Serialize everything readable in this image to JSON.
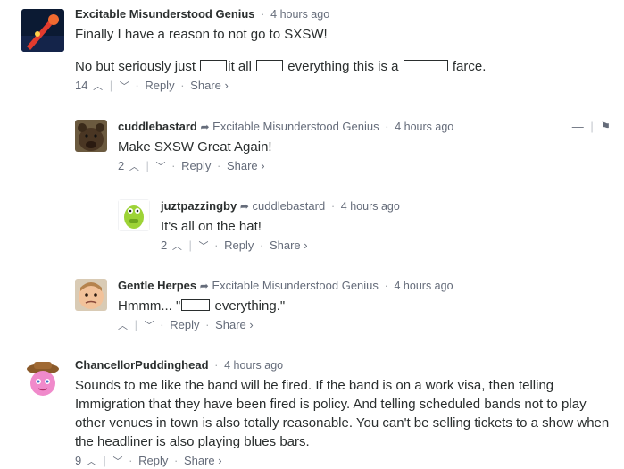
{
  "comments": [
    {
      "author": "Excitable Misunderstood Genius",
      "time": "4 hours ago",
      "lines": [
        "Finally I have a reason to not go to SXSW!"
      ],
      "line2": {
        "a": "No but seriously just",
        "b": "it all",
        "c": "everything this is a",
        "d": "farce."
      },
      "votes": "14",
      "reply": "Reply",
      "share": "Share ›"
    },
    {
      "author": "cuddlebastard",
      "parent": "Excitable Misunderstood Genius",
      "time": "4 hours ago",
      "text": "Make SXSW Great Again!",
      "votes": "2",
      "reply": "Reply",
      "share": "Share ›",
      "collapse": "—",
      "flag": "⚑"
    },
    {
      "author": "juztpazzingby",
      "parent": "cuddlebastard",
      "time": "4 hours ago",
      "text": "It's all on the hat!",
      "votes": "2",
      "reply": "Reply",
      "share": "Share ›"
    },
    {
      "author": "Gentle Herpes",
      "parent": "Excitable Misunderstood Genius",
      "time": "4 hours ago",
      "text_a": "Hmmm... \"",
      "text_b": "everything.\"",
      "votes": "",
      "reply": "Reply",
      "share": "Share ›"
    },
    {
      "author": "ChancellorPuddinghead",
      "time": "4 hours ago",
      "text": "Sounds to me like the band will be fired. If the band is on a work visa, then telling Immigration that they have been fired is policy. And telling scheduled bands not to play other venues in town is also totally reasonable. You can't be selling tickets to a show when the headliner is also playing blues bars.",
      "votes": "9",
      "reply": "Reply",
      "share": "Share ›"
    }
  ],
  "symbols": {
    "separator": "·",
    "upvote": "︿",
    "downvote": "﹀",
    "bar": "|",
    "reply_arrow": "➦"
  }
}
